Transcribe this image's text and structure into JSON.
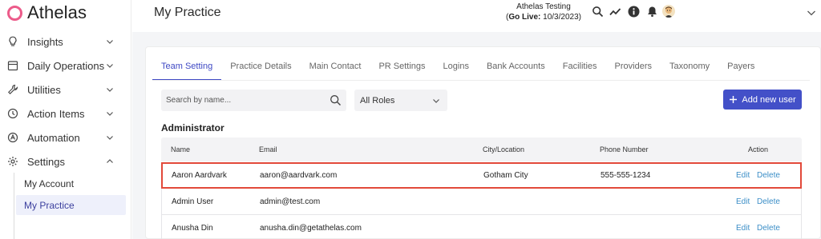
{
  "app": {
    "logo_text": "Athelas"
  },
  "sidebar": {
    "items": [
      {
        "label": "Insights",
        "icon": "lightbulb-icon"
      },
      {
        "label": "Daily Operations",
        "icon": "calendar-icon"
      },
      {
        "label": "Utilities",
        "icon": "wrench-icon"
      },
      {
        "label": "Action Items",
        "icon": "clock-icon"
      },
      {
        "label": "Automation",
        "icon": "automation-icon"
      },
      {
        "label": "Settings",
        "icon": "gear-icon"
      }
    ],
    "sub_items": [
      {
        "label": "My Account",
        "active": false
      },
      {
        "label": "My Practice",
        "active": true
      }
    ]
  },
  "header": {
    "page_title": "My Practice",
    "org_name": "Athelas Testing",
    "go_live_label": "Go Live:",
    "go_live_date": "10/3/2023",
    "open_paren": "(",
    "close_paren": ")",
    "icons": [
      "search-icon",
      "trend-icon",
      "info-icon",
      "bell-icon",
      "avatar"
    ]
  },
  "tabs": [
    "Team Setting",
    "Practice Details",
    "Main Contact",
    "PR Settings",
    "Logins",
    "Bank Accounts",
    "Facilities",
    "Providers",
    "Taxonomy",
    "Payers"
  ],
  "active_tab": "Team Setting",
  "filters": {
    "search_placeholder": "Search by name...",
    "role_selected": "All Roles",
    "add_button_label": "Add new user"
  },
  "section": {
    "title": "Administrator"
  },
  "table": {
    "columns": [
      "Name",
      "Email",
      "City/Location",
      "Phone Number",
      "Action"
    ],
    "rows": [
      {
        "name": "Aaron Aardvark",
        "email": "aaron@aardvark.com",
        "city": "Gotham City",
        "phone": "555-555-1234",
        "edit": "Edit",
        "delete": "Delete"
      },
      {
        "name": "Admin User",
        "email": "admin@test.com",
        "city": "",
        "phone": "",
        "edit": "Edit",
        "delete": "Delete"
      },
      {
        "name": "Anusha Din",
        "email": "anusha.din@getathelas.com",
        "city": "",
        "phone": "",
        "edit": "Edit",
        "delete": "Delete"
      }
    ]
  },
  "colors": {
    "accent": "#4350c8",
    "logo_ring": "#ec5b8a",
    "link": "#3b8ec7",
    "highlight_border": "#e2493a",
    "active_nav_bg": "#eef0fb"
  }
}
